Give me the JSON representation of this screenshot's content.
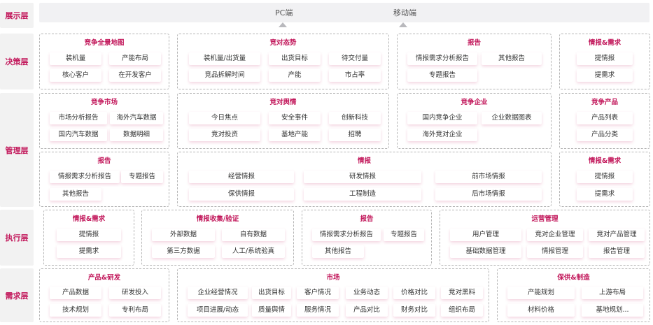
{
  "layers": {
    "display": "展示层",
    "decision": "决策层",
    "management": "管理层",
    "execution": "执行层",
    "demand": "需求层"
  },
  "display": {
    "pc": "PC端",
    "mobile": "移动端"
  },
  "cards": [
    {
      "id": "c1",
      "title": "竞争全景地图",
      "items": [
        "装机量",
        "产能布局",
        "核心客户",
        "在开发客户"
      ]
    },
    {
      "id": "c2",
      "title": "竞对态势",
      "items": [
        "装机量/出货量",
        "出货目标",
        "待交付量",
        "竞品拆解时间",
        "产能",
        "市占率"
      ]
    },
    {
      "id": "c3",
      "title": "报告",
      "items": [
        "情报需求分析报告",
        "其他报告",
        "专题报告"
      ]
    },
    {
      "id": "c4",
      "title": "情报&需求",
      "items": [
        "提情报",
        "提需求"
      ]
    },
    {
      "id": "c5",
      "title": "竞争市场",
      "items": [
        "市场分析报告",
        "海外汽车数据",
        "国内汽车数据",
        "数据明细"
      ]
    },
    {
      "id": "c6",
      "title": "竞对舆情",
      "items": [
        "今日焦点",
        "安全事件",
        "创新科技",
        "竞对投资",
        "基地产能",
        "招聘"
      ]
    },
    {
      "id": "c7",
      "title": "竞争企业",
      "items": [
        "国内竞争企业",
        "企业数据图表",
        "海外竞对企业"
      ]
    },
    {
      "id": "c8",
      "title": "竞争产品",
      "items": [
        "产品列表",
        "产品分类"
      ]
    },
    {
      "id": "c9",
      "title": "报告",
      "items": [
        "情报需求分析报告",
        "专题报告",
        "其他报告"
      ]
    },
    {
      "id": "c10",
      "title": "情报",
      "items": [
        "经营情报",
        "研发情报",
        "前市场情报",
        "保供情报",
        "工程制造",
        "后市场情报"
      ]
    },
    {
      "id": "c11",
      "title": "情报&需求",
      "items": [
        "提情报",
        "提需求"
      ]
    },
    {
      "id": "c12",
      "title": "情报&需求",
      "items": [
        "提情报",
        "提需求"
      ]
    },
    {
      "id": "c13",
      "title": "情报收集/验证",
      "items": [
        "外部数据",
        "自有数据",
        "第三方数据",
        "人工/系统验真"
      ]
    },
    {
      "id": "c14",
      "title": "报告",
      "items": [
        "情报需求分析报告",
        "专题报告",
        "其他报告"
      ]
    },
    {
      "id": "c15",
      "title": "运营管理",
      "items": [
        "用户管理",
        "竞对企业管理",
        "竞对产品管理",
        "基础数据管理",
        "情报管理",
        "报告管理"
      ]
    },
    {
      "id": "c16",
      "title": "产品&研发",
      "items": [
        "产品数据",
        "研发投入",
        "技术规划",
        "专利布局"
      ]
    },
    {
      "id": "c17",
      "title": "市场",
      "items": [
        "企业经营情况",
        "出货目标",
        "客户情况",
        "业务动态",
        "价格对比",
        "竞对黑料",
        "项目进展/动态",
        "质量舆情",
        "服务情况",
        "产品对比",
        "财务对比",
        "组织布局"
      ]
    },
    {
      "id": "c18",
      "title": "保供&制造",
      "items": [
        "产能规划",
        "上游布局",
        "材料价格",
        "基地规划..."
      ]
    }
  ]
}
